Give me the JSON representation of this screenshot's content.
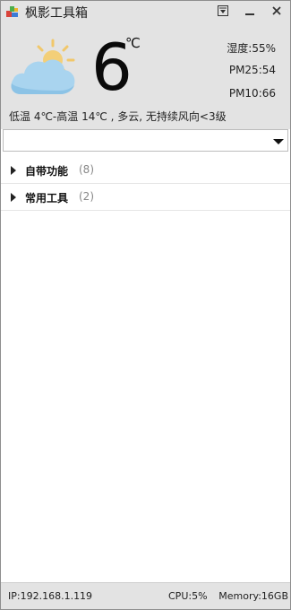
{
  "app": {
    "title": "枫影工具箱"
  },
  "weather": {
    "temperature": "6",
    "unit": "℃",
    "humidity": "湿度:55%",
    "time_1": "PM25:54",
    "time_2": "PM10:66",
    "summary": "低温 4℃-高温 14℃ , 多云, 无持续风向<3级",
    "icon": "partly-cloudy-icon"
  },
  "dropdown": {
    "value": ""
  },
  "tree": {
    "items": [
      {
        "label": "自带功能",
        "count": "(8)"
      },
      {
        "label": "常用工具",
        "count": "(2)"
      }
    ]
  },
  "status": {
    "ip": "IP:192.168.1.119",
    "cpu": "CPU:5%",
    "memory": "Memory:16GB"
  },
  "colors": {
    "panel": "#e3e3e3",
    "cloud": "#a9d4ef",
    "sun": "#f1c76a"
  }
}
